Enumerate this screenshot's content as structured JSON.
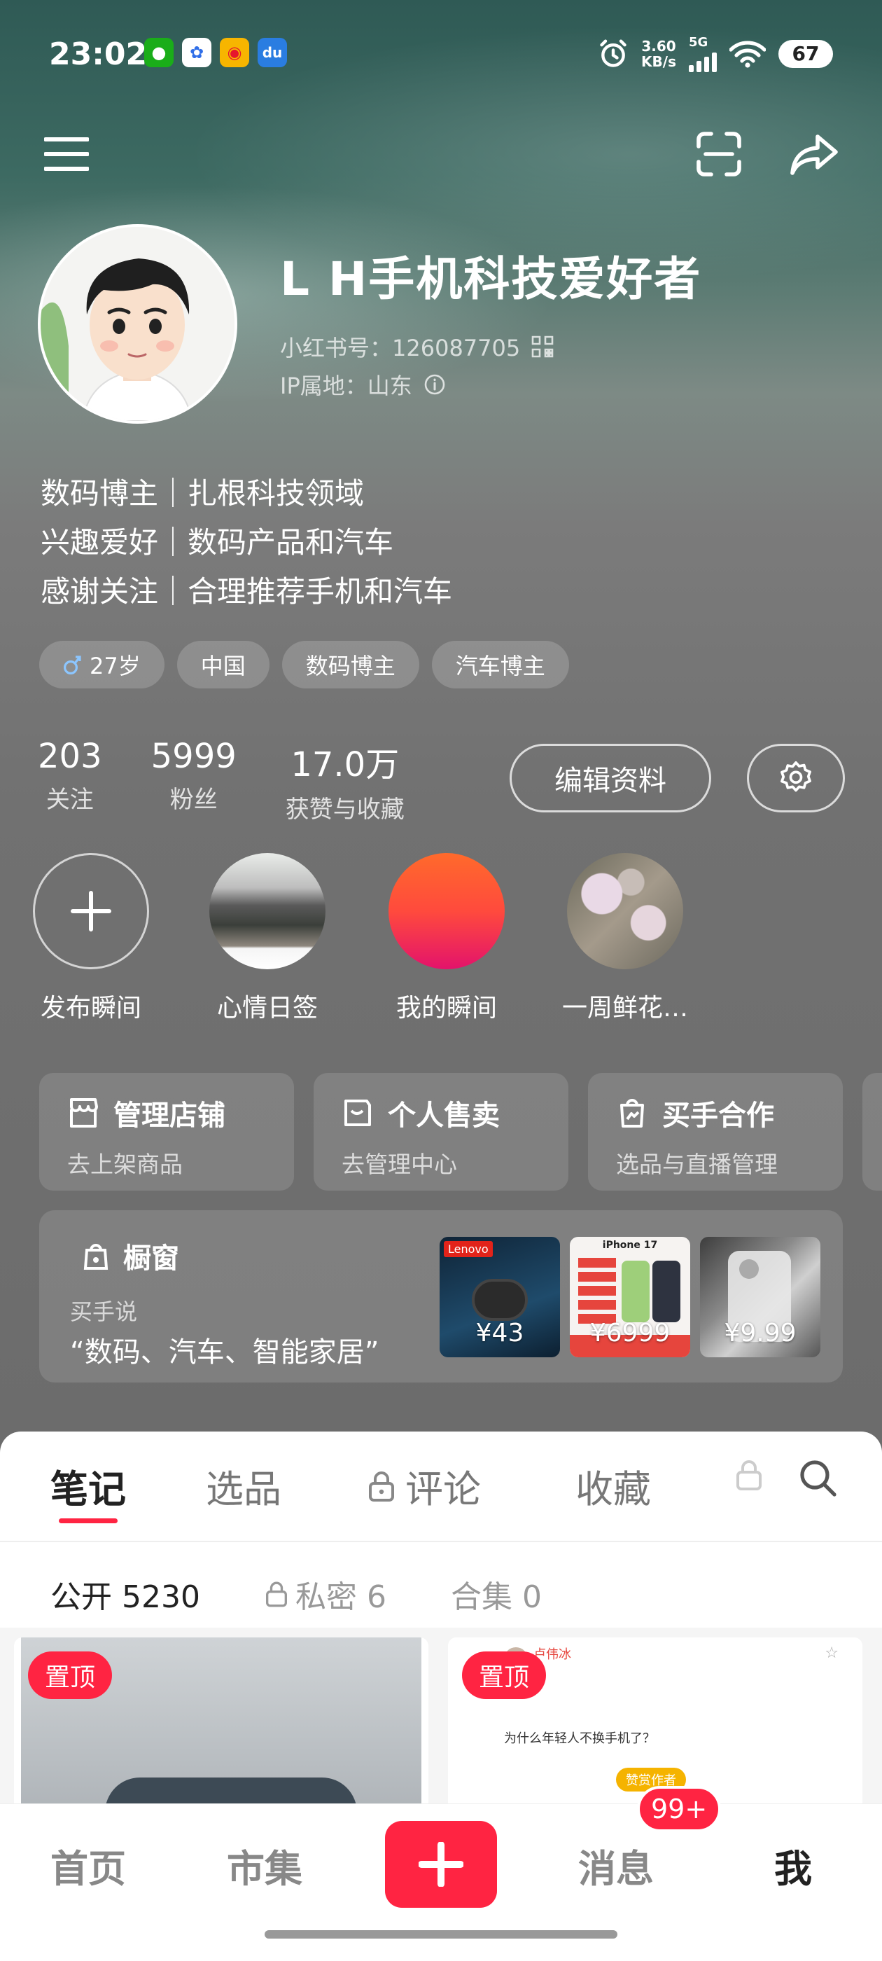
{
  "status_bar": {
    "time": "23:02",
    "speed": "3.60",
    "speed_unit": "KB/s",
    "network": "5G",
    "battery": "67",
    "apps": [
      "wechat-icon",
      "baidu-icon",
      "weibo-icon",
      "du-icon"
    ]
  },
  "profile": {
    "name": "L H手机科技爱好者",
    "id_label": "小红书号：126087705",
    "ip_label": "IP属地：山东",
    "bio": [
      "数码博主｜扎根科技领域",
      "兴趣爱好｜数码产品和汽车",
      "感谢关注｜合理推荐手机和汽车"
    ],
    "tags": [
      "27岁",
      "中国",
      "数码博主",
      "汽车博主"
    ]
  },
  "stats": [
    {
      "value": "203",
      "label": "关注"
    },
    {
      "value": "5999",
      "label": "粉丝"
    },
    {
      "value": "17.0万",
      "label": "获赞与收藏"
    }
  ],
  "edit_profile_label": "编辑资料",
  "moments": [
    "发布瞬间",
    "心情日签",
    "我的瞬间",
    "一周鲜花…"
  ],
  "services": [
    {
      "title": "管理店铺",
      "sub": "去上架商品"
    },
    {
      "title": "个人售卖",
      "sub": "去管理中心"
    },
    {
      "title": "买手合作",
      "sub": "选品与直播管理"
    }
  ],
  "showcase": {
    "title": "橱窗",
    "buyer_says": "买手说",
    "quote": "“数码、汽车、智能家居”",
    "products": [
      {
        "brand": "Lenovo",
        "price": "¥43"
      },
      {
        "brand": "iPhone 17",
        "price": "¥6999"
      },
      {
        "brand": "",
        "price": "¥9.99"
      }
    ]
  },
  "tabs": [
    "笔记",
    "选品",
    "评论",
    "收藏"
  ],
  "subtabs": [
    "公开 5230",
    "私密 6",
    "合集 0"
  ],
  "pinned_label": "置顶",
  "note_preview": {
    "author": "卢伟冰",
    "question": "为什么年轻人不换手机了？",
    "button": "赞赏作者"
  },
  "bottom_nav": {
    "home": "首页",
    "market": "市集",
    "messages": "消息",
    "me": "我",
    "badge": "99+"
  },
  "colors": {
    "accent": "#ff2442"
  }
}
